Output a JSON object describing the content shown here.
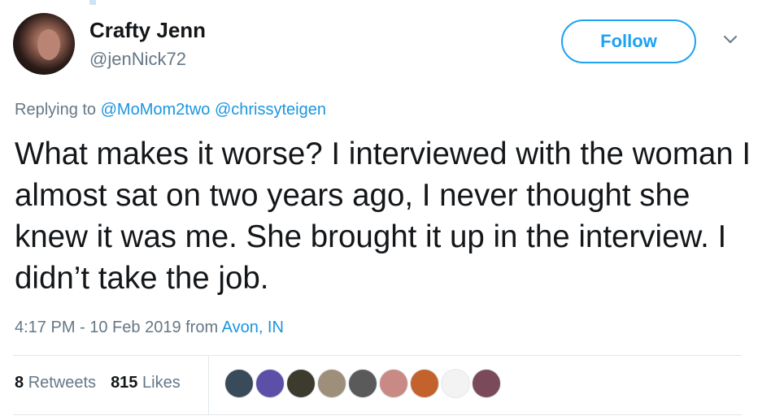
{
  "user": {
    "name": "Crafty Jenn",
    "handle": "@jenNick72",
    "avatar_icon": "user-avatar"
  },
  "follow_label": "Follow",
  "menu_icon": "chevron-down-icon",
  "reply": {
    "prefix": "Replying to",
    "mentions": [
      "@MoMom2two",
      "@chrissyteigen"
    ]
  },
  "text": "What makes it worse? I interviewed with the woman I almost sat on two years ago, I never thought she knew it was me. She brought it up in the interview. I didn’t take the job.",
  "meta": {
    "time_date": "4:17 PM - 10 Feb 2019 from",
    "location": "Avon, IN"
  },
  "stats": {
    "retweets_count": "8",
    "retweets_label": "Retweets",
    "likes_count": "815",
    "likes_label": "Likes"
  },
  "likers": [
    {
      "name": "liker-1",
      "color": "#3a4a5a"
    },
    {
      "name": "liker-2",
      "color": "#5b4fa8"
    },
    {
      "name": "liker-3",
      "color": "#3d3a2e"
    },
    {
      "name": "liker-4",
      "color": "#9d8f7a"
    },
    {
      "name": "liker-5",
      "color": "#5a5a5a"
    },
    {
      "name": "liker-6",
      "color": "#c98a86"
    },
    {
      "name": "liker-7",
      "color": "#c4622d"
    },
    {
      "name": "liker-8",
      "color": "#f3f3f3"
    },
    {
      "name": "liker-9",
      "color": "#7b4a5a"
    }
  ],
  "colors": {
    "accent": "#1da1f2",
    "link": "#1b95e0",
    "secondary_text": "#657786",
    "divider": "#e1e8ed"
  }
}
